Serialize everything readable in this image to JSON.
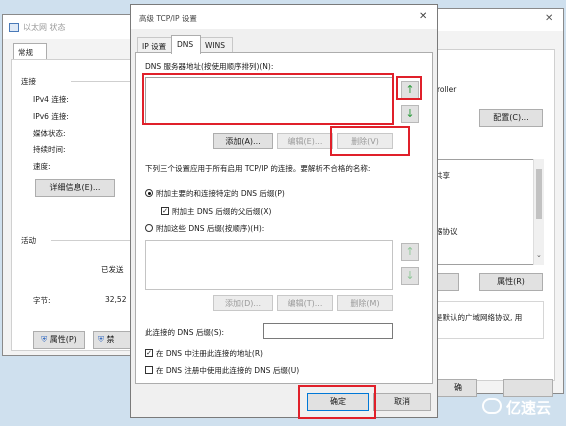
{
  "background_window": {
    "title": "以太网 状态",
    "tab": "常规",
    "sections": {
      "connection": "连接",
      "activity": "活动"
    },
    "fields": [
      "IPv4 连接:",
      "IPv6 连接:",
      "媒体状态:",
      "持续时间:",
      "速度:"
    ],
    "details_button": "详细信息(E)...",
    "sent_label": "已发送",
    "bytes_label": "字节:",
    "bytes_value": "32,52",
    "properties_button": "属性(P)",
    "disable_button": "禁"
  },
  "right_window": {
    "adapter_text": "roller",
    "configure_button": "配置(C)...",
    "share_text": "共享",
    "item1": ")",
    "item2": "器协议",
    "item3": ")",
    "properties_button": "属性(R)",
    "description": "是默认的广域网络协议, 用",
    "ok_fragment": "确"
  },
  "dialog": {
    "title": "高级 TCP/IP 设置",
    "tabs": [
      "IP 设置",
      "DNS",
      "WINS"
    ],
    "active_tab": "DNS",
    "dns_servers_label": "DNS 服务器地址(按使用顺序排列)(N):",
    "add_button": "添加(A)...",
    "edit_button": "编辑(E)...",
    "remove_button": "删除(V)",
    "rules_text": "下列三个设置应用于所有启用 TCP/IP 的连接。要解析不合格的名称:",
    "radio_primary": "附加主要的和连接特定的 DNS 后缀(P)",
    "check_parent": "附加主 DNS 后缀的父后缀(X)",
    "radio_suffixes": "附加这些 DNS 后缀(按顺序)(H):",
    "add_button2": "添加(D)...",
    "edit_button2": "编辑(T)...",
    "remove_button2": "删除(M)",
    "conn_suffix_label": "此连接的 DNS 后缀(S):",
    "conn_suffix_value": "",
    "check_register": "在 DNS 中注册此连接的地址(R)",
    "check_use_suffix": "在 DNS 注册中使用此连接的 DNS 后缀(U)",
    "ok_button": "确定",
    "cancel_button": "取消",
    "up_arrow": "↑",
    "down_arrow": "↓",
    "close_glyph": "✕",
    "checkmark": "✓"
  },
  "watermark": {
    "text": "亿速云"
  },
  "colors": {
    "highlight_red": "#e0202a",
    "accent_blue": "#0078d7"
  }
}
